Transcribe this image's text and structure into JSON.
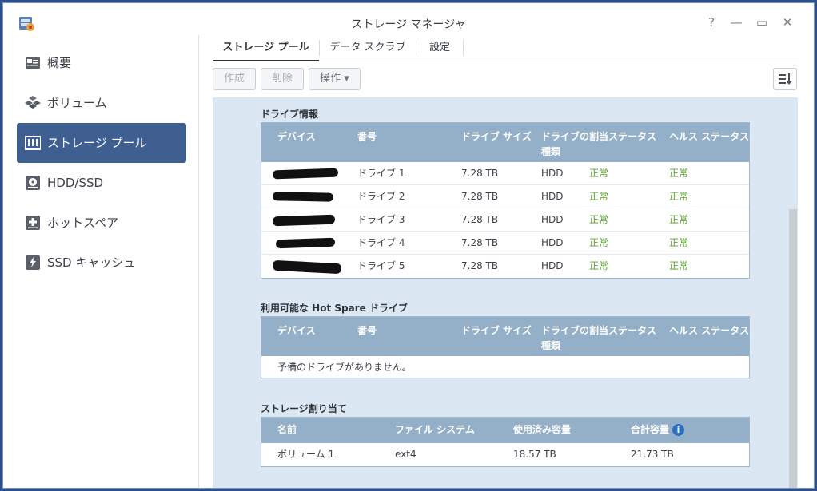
{
  "window": {
    "title": "ストレージ マネージャ",
    "help": "?",
    "minimize": "—",
    "maximize": "▭",
    "close": "✕"
  },
  "sidebar": {
    "items": [
      {
        "label": "概要",
        "icon": "overview-icon"
      },
      {
        "label": "ボリューム",
        "icon": "volume-icon"
      },
      {
        "label": "ストレージ プール",
        "icon": "storage-pool-icon",
        "active": true
      },
      {
        "label": "HDD/SSD",
        "icon": "hdd-icon"
      },
      {
        "label": "ホットスペア",
        "icon": "hot-spare-icon"
      },
      {
        "label": "SSD キャッシュ",
        "icon": "ssd-cache-icon"
      }
    ]
  },
  "tabs": [
    {
      "label": "ストレージ プール",
      "active": true
    },
    {
      "label": "データ スクラブ"
    },
    {
      "label": "設定"
    }
  ],
  "toolbar": {
    "create": "作成",
    "delete": "削除",
    "operation": "操作 ▾"
  },
  "drive_info": {
    "title": "ドライブ情報",
    "headers": {
      "device": "デバイス",
      "number": "番号",
      "size": "ドライブ サイズ",
      "type_a": "ドライブの",
      "type_b": "種類",
      "assign": "割当ステータス",
      "health": "ヘルス ステータス"
    },
    "rows": [
      {
        "number": "ドライブ 1",
        "size": "7.28 TB",
        "type": "HDD",
        "assign": "正常",
        "health": "正常"
      },
      {
        "number": "ドライブ 2",
        "size": "7.28 TB",
        "type": "HDD",
        "assign": "正常",
        "health": "正常"
      },
      {
        "number": "ドライブ 3",
        "size": "7.28 TB",
        "type": "HDD",
        "assign": "正常",
        "health": "正常"
      },
      {
        "number": "ドライブ 4",
        "size": "7.28 TB",
        "type": "HDD",
        "assign": "正常",
        "health": "正常"
      },
      {
        "number": "ドライブ 5",
        "size": "7.28 TB",
        "type": "HDD",
        "assign": "正常",
        "health": "正常"
      }
    ]
  },
  "hot_spare": {
    "title": "利用可能な Hot Spare ドライブ",
    "headers": {
      "device": "デバイス",
      "number": "番号",
      "size": "ドライブ サイズ",
      "type_a": "ドライブの",
      "type_b": "種類",
      "assign": "割当ステータス",
      "health": "ヘルス ステータス"
    },
    "empty": "予備のドライブがありません。"
  },
  "allocation": {
    "title": "ストレージ割り当て",
    "headers": {
      "name": "名前",
      "fs": "ファイル システム",
      "used": "使用済み容量",
      "total": "合計容量"
    },
    "rows": [
      {
        "name": "ボリューム 1",
        "fs": "ext4",
        "used": "18.57 TB",
        "total": "21.73 TB"
      }
    ]
  },
  "colors": {
    "accent": "#3e5f90",
    "header": "#94b0c8",
    "ok": "#5a9e2f",
    "content_bg": "#dce7f4"
  }
}
